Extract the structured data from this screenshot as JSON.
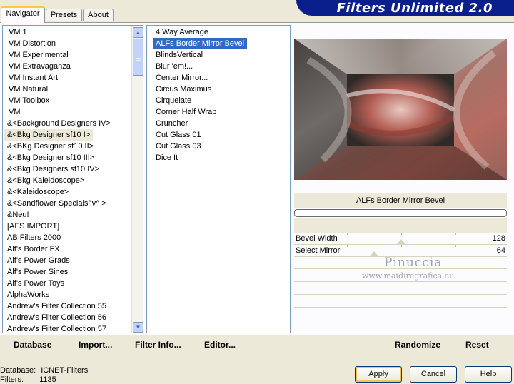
{
  "banner": {
    "title": "Filters Unlimited 2.0"
  },
  "tabs": [
    {
      "label": "Navigator",
      "active": true
    },
    {
      "label": "Presets",
      "active": false
    },
    {
      "label": "About",
      "active": false
    }
  ],
  "categories": [
    "VM 1",
    "VM Distortion",
    "VM Experimental",
    "VM Extravaganza",
    "VM Instant Art",
    "VM Natural",
    "VM Toolbox",
    "VM",
    "&<Background Designers IV>",
    "&<Bkg Designer sf10 I>",
    "&<BKg Designer sf10 II>",
    "&<Bkg Designer sf10 III>",
    "&<Bkg Designers sf10 IV>",
    "&<Bkg Kaleidoscope>",
    "&<Kaleidoscope>",
    "&<Sandflower Specials^v^ >",
    "&Neu!",
    "[AFS IMPORT]",
    "AB Filters 2000",
    "Alf's Border FX",
    "Alf's Power Grads",
    "Alf's Power Sines",
    "Alf's Power Toys",
    "AlphaWorks",
    "Andrew's Filter Collection 55",
    "Andrew's Filter Collection 56",
    "Andrew's Filter Collection 57"
  ],
  "selected_category_index": 9,
  "filters": [
    "4 Way Average",
    "ALFs Border Mirror Bevel",
    "BlindsVertical",
    "Blur 'em!...",
    "Center Mirror...",
    "Circus Maximus",
    "Cirquelate",
    "Corner Half Wrap",
    "Cruncher",
    "Cut Glass 01",
    "Cut Glass 03",
    "Dice It"
  ],
  "selected_filter_index": 1,
  "selected_filter_name": "ALFs Border Mirror Bevel",
  "params": [
    {
      "label": "Bevel Width",
      "value": "128",
      "level": 0.5
    },
    {
      "label": "Select Mirror",
      "value": "64",
      "level": 0.25
    }
  ],
  "watermark": {
    "line1": "Pinuccia",
    "line2": "www.maidiregrafica.eu"
  },
  "link_buttons": [
    {
      "id": "database",
      "label": "Database"
    },
    {
      "id": "import",
      "label": "Import..."
    },
    {
      "id": "filter-info",
      "label": "Filter Info..."
    },
    {
      "id": "editor",
      "label": "Editor..."
    },
    {
      "id": "randomize",
      "label": "Randomize"
    },
    {
      "id": "reset",
      "label": "Reset"
    }
  ],
  "info": {
    "database_label": "Database:",
    "database_value": "ICNET-Filters",
    "filters_label": "Filters:",
    "filters_value": "1135"
  },
  "buttons": {
    "apply": "Apply",
    "cancel": "Cancel",
    "help": "Help"
  },
  "colors": {
    "banner": "#0a1f8c",
    "selection": "#316ac5",
    "dialog": "#ece9d8"
  }
}
